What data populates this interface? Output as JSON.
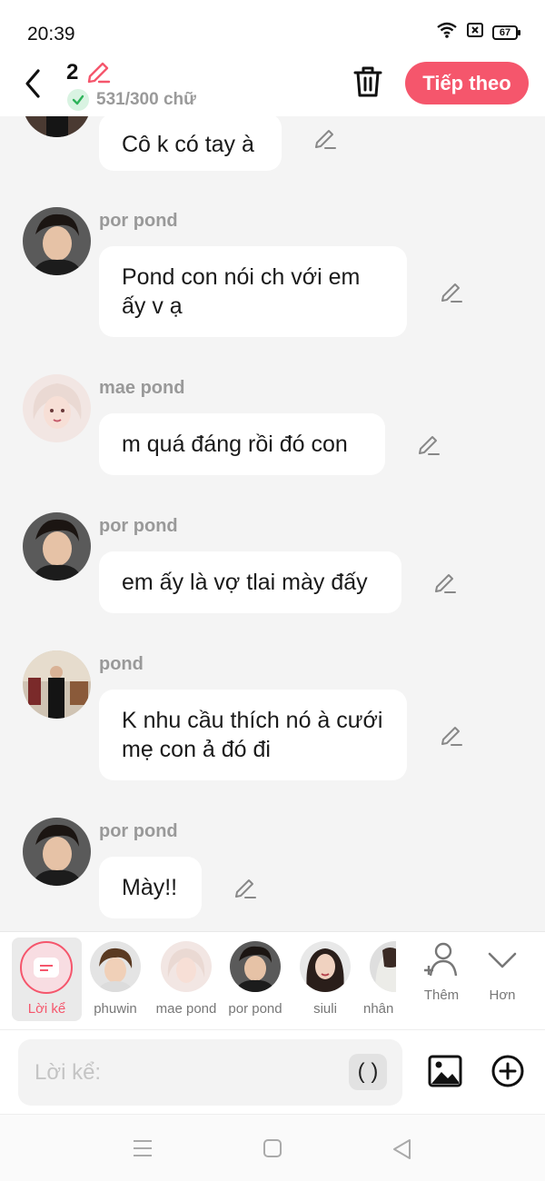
{
  "status_bar": {
    "time": "20:39",
    "battery": "67"
  },
  "header": {
    "count": "2",
    "char_counter": "531/300 chữ",
    "next_label": "Tiếp theo"
  },
  "messages": [
    {
      "name": "",
      "text": "Cô k có tay à"
    },
    {
      "name": "por pond",
      "text": "Pond con nói ch với em ấy v ạ"
    },
    {
      "name": "mae pond",
      "text": "m quá đáng rồi đó con"
    },
    {
      "name": "por pond",
      "text": "em ấy là vợ tlai mày đấy"
    },
    {
      "name": "pond",
      "text": "K nhu cầu thích nó à cưới mẹ con ả đó đi"
    },
    {
      "name": "por pond",
      "text": "Mày!!"
    }
  ],
  "charbar": {
    "narrator_label": "Lời kể",
    "characters": [
      "phuwin",
      "mae pond",
      "por pond",
      "siuli",
      "nhân"
    ],
    "add_label": "Thêm",
    "more_label": "Hơn"
  },
  "composer": {
    "placeholder": "Lời kể:",
    "paren": "( )"
  },
  "colors": {
    "accent": "#f5566c",
    "background": "#f4f4f4",
    "bubble": "#ffffff"
  }
}
